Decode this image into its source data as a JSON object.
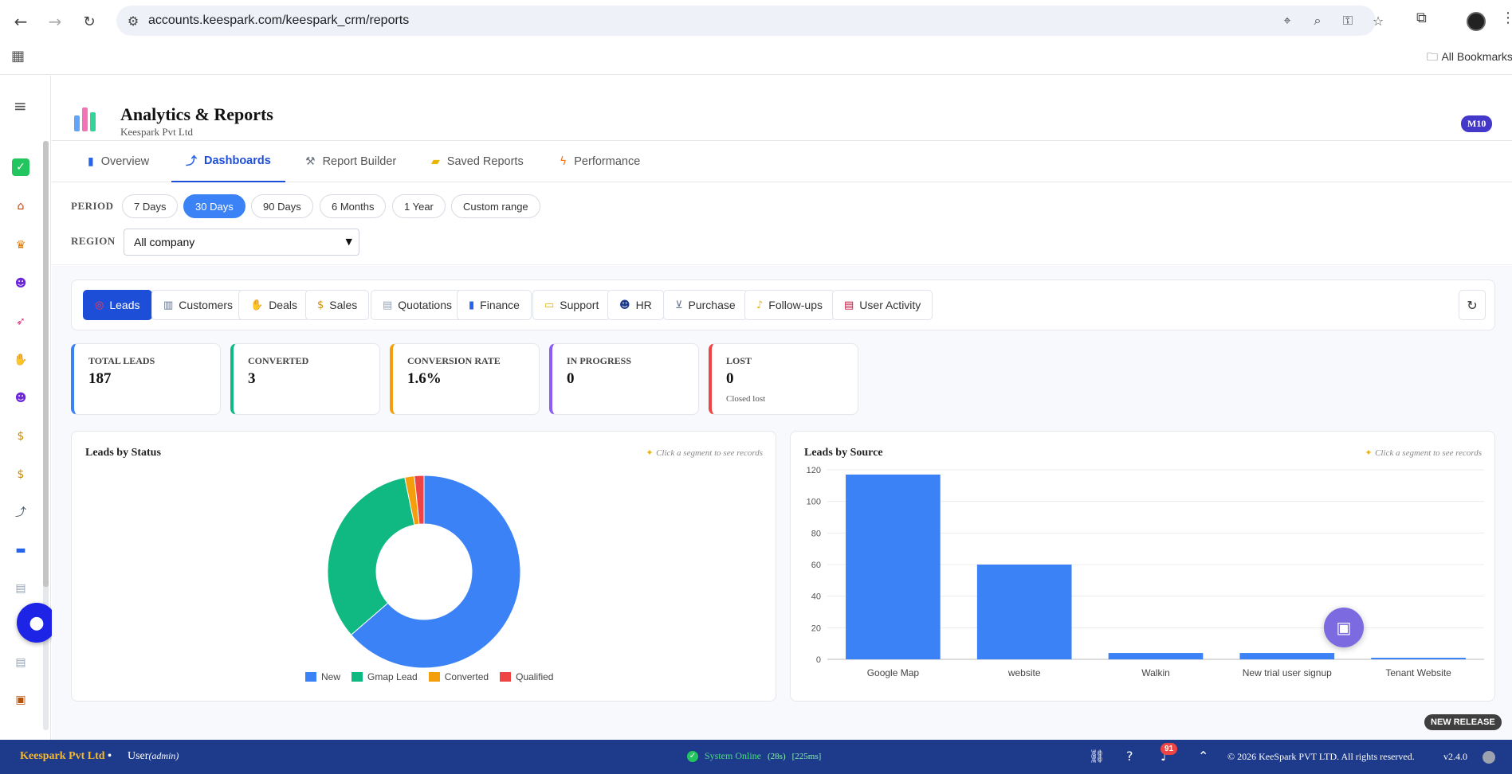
{
  "browser": {
    "url": "accounts.keespark.com/keespark_crm/reports",
    "bookmarks_label": "All Bookmarks"
  },
  "header": {
    "title": "Analytics & Reports",
    "subtitle": "Keespark Pvt Ltd",
    "badge": "M10"
  },
  "tabs": [
    {
      "label": "Overview",
      "icon": "bar-chart-icon"
    },
    {
      "label": "Dashboards",
      "icon": "trend-chart-icon",
      "active": true
    },
    {
      "label": "Report Builder",
      "icon": "hammer-icon"
    },
    {
      "label": "Saved Reports",
      "icon": "folder-icon"
    },
    {
      "label": "Performance",
      "icon": "lightning-icon"
    }
  ],
  "filters": {
    "period_label": "PERIOD",
    "periods": [
      "7 Days",
      "30 Days",
      "90 Days",
      "6 Months",
      "1 Year",
      "Custom range"
    ],
    "active_period": "30 Days",
    "region_label": "REGION",
    "region_value": "All company"
  },
  "modules": [
    {
      "label": "Leads",
      "active": true
    },
    {
      "label": "Customers"
    },
    {
      "label": "Deals"
    },
    {
      "label": "Sales"
    },
    {
      "label": "Quotations"
    },
    {
      "label": "Finance"
    },
    {
      "label": "Support"
    },
    {
      "label": "HR"
    },
    {
      "label": "Purchase"
    },
    {
      "label": "Follow-ups"
    },
    {
      "label": "User Activity"
    }
  ],
  "kpis": [
    {
      "label": "TOTAL LEADS",
      "value": "187",
      "sub": "",
      "color": "#3b82f6"
    },
    {
      "label": "CONVERTED",
      "value": "3",
      "sub": "",
      "color": "#10b981"
    },
    {
      "label": "CONVERSION RATE",
      "value": "1.6%",
      "sub": "",
      "color": "#f59e0b"
    },
    {
      "label": "IN PROGRESS",
      "value": "0",
      "sub": "",
      "color": "#8b5cf6"
    },
    {
      "label": "LOST",
      "value": "0",
      "sub": "Closed lost",
      "color": "#ef4444"
    }
  ],
  "panels": {
    "status_title": "Leads by Status",
    "source_title": "Leads by Source",
    "hint": "Click a segment to see records"
  },
  "chart_data": [
    {
      "type": "pie",
      "title": "Leads by Status",
      "labels": [
        "New",
        "Gmap Lead",
        "Converted",
        "Qualified"
      ],
      "values": [
        119,
        62,
        3,
        3
      ],
      "colors": [
        "#3b82f6",
        "#10b981",
        "#f59e0b",
        "#ef4444"
      ],
      "legend": "bottom"
    },
    {
      "type": "bar",
      "title": "Leads by Source",
      "categories": [
        "Google Map",
        "website",
        "Walkin",
        "New trial user signup",
        "Tenant Website"
      ],
      "values": [
        117,
        60,
        4,
        4,
        1
      ],
      "yticks": [
        "0",
        "20",
        "40",
        "60",
        "80",
        "100",
        "120"
      ],
      "ylim": [
        0,
        120
      ],
      "color": "#3b82f6",
      "grid": true
    }
  ],
  "footer": {
    "company": "Keespark Pvt Ltd",
    "separator": "•",
    "user": "User",
    "role": "(admin)",
    "status": "System Online",
    "uptime": "(28s)",
    "latency": "[225ms]",
    "notifications": "91",
    "copyright": "© 2026 KeeSpark PVT LTD. All rights reserved.",
    "version": "v2.4.0"
  },
  "new_release": "NEW RELEASE"
}
